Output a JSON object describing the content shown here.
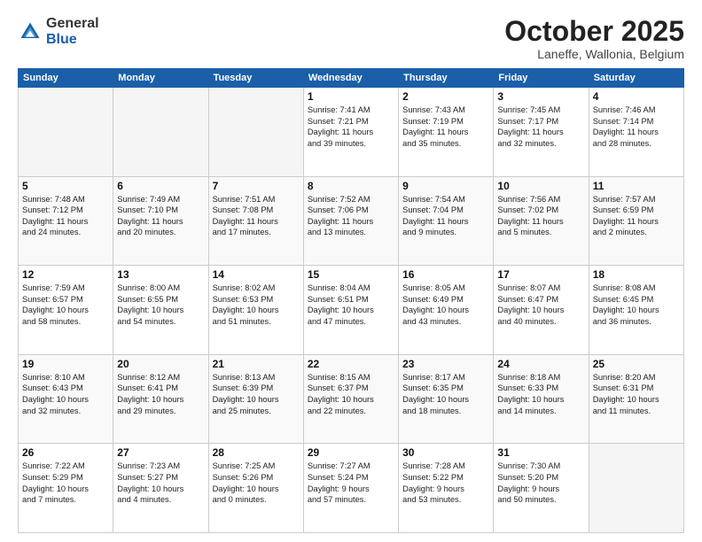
{
  "header": {
    "logo_general": "General",
    "logo_blue": "Blue",
    "month": "October 2025",
    "location": "Laneffe, Wallonia, Belgium"
  },
  "weekdays": [
    "Sunday",
    "Monday",
    "Tuesday",
    "Wednesday",
    "Thursday",
    "Friday",
    "Saturday"
  ],
  "weeks": [
    [
      {
        "day": "",
        "info": ""
      },
      {
        "day": "",
        "info": ""
      },
      {
        "day": "",
        "info": ""
      },
      {
        "day": "1",
        "info": "Sunrise: 7:41 AM\nSunset: 7:21 PM\nDaylight: 11 hours\nand 39 minutes."
      },
      {
        "day": "2",
        "info": "Sunrise: 7:43 AM\nSunset: 7:19 PM\nDaylight: 11 hours\nand 35 minutes."
      },
      {
        "day": "3",
        "info": "Sunrise: 7:45 AM\nSunset: 7:17 PM\nDaylight: 11 hours\nand 32 minutes."
      },
      {
        "day": "4",
        "info": "Sunrise: 7:46 AM\nSunset: 7:14 PM\nDaylight: 11 hours\nand 28 minutes."
      }
    ],
    [
      {
        "day": "5",
        "info": "Sunrise: 7:48 AM\nSunset: 7:12 PM\nDaylight: 11 hours\nand 24 minutes."
      },
      {
        "day": "6",
        "info": "Sunrise: 7:49 AM\nSunset: 7:10 PM\nDaylight: 11 hours\nand 20 minutes."
      },
      {
        "day": "7",
        "info": "Sunrise: 7:51 AM\nSunset: 7:08 PM\nDaylight: 11 hours\nand 17 minutes."
      },
      {
        "day": "8",
        "info": "Sunrise: 7:52 AM\nSunset: 7:06 PM\nDaylight: 11 hours\nand 13 minutes."
      },
      {
        "day": "9",
        "info": "Sunrise: 7:54 AM\nSunset: 7:04 PM\nDaylight: 11 hours\nand 9 minutes."
      },
      {
        "day": "10",
        "info": "Sunrise: 7:56 AM\nSunset: 7:02 PM\nDaylight: 11 hours\nand 5 minutes."
      },
      {
        "day": "11",
        "info": "Sunrise: 7:57 AM\nSunset: 6:59 PM\nDaylight: 11 hours\nand 2 minutes."
      }
    ],
    [
      {
        "day": "12",
        "info": "Sunrise: 7:59 AM\nSunset: 6:57 PM\nDaylight: 10 hours\nand 58 minutes."
      },
      {
        "day": "13",
        "info": "Sunrise: 8:00 AM\nSunset: 6:55 PM\nDaylight: 10 hours\nand 54 minutes."
      },
      {
        "day": "14",
        "info": "Sunrise: 8:02 AM\nSunset: 6:53 PM\nDaylight: 10 hours\nand 51 minutes."
      },
      {
        "day": "15",
        "info": "Sunrise: 8:04 AM\nSunset: 6:51 PM\nDaylight: 10 hours\nand 47 minutes."
      },
      {
        "day": "16",
        "info": "Sunrise: 8:05 AM\nSunset: 6:49 PM\nDaylight: 10 hours\nand 43 minutes."
      },
      {
        "day": "17",
        "info": "Sunrise: 8:07 AM\nSunset: 6:47 PM\nDaylight: 10 hours\nand 40 minutes."
      },
      {
        "day": "18",
        "info": "Sunrise: 8:08 AM\nSunset: 6:45 PM\nDaylight: 10 hours\nand 36 minutes."
      }
    ],
    [
      {
        "day": "19",
        "info": "Sunrise: 8:10 AM\nSunset: 6:43 PM\nDaylight: 10 hours\nand 32 minutes."
      },
      {
        "day": "20",
        "info": "Sunrise: 8:12 AM\nSunset: 6:41 PM\nDaylight: 10 hours\nand 29 minutes."
      },
      {
        "day": "21",
        "info": "Sunrise: 8:13 AM\nSunset: 6:39 PM\nDaylight: 10 hours\nand 25 minutes."
      },
      {
        "day": "22",
        "info": "Sunrise: 8:15 AM\nSunset: 6:37 PM\nDaylight: 10 hours\nand 22 minutes."
      },
      {
        "day": "23",
        "info": "Sunrise: 8:17 AM\nSunset: 6:35 PM\nDaylight: 10 hours\nand 18 minutes."
      },
      {
        "day": "24",
        "info": "Sunrise: 8:18 AM\nSunset: 6:33 PM\nDaylight: 10 hours\nand 14 minutes."
      },
      {
        "day": "25",
        "info": "Sunrise: 8:20 AM\nSunset: 6:31 PM\nDaylight: 10 hours\nand 11 minutes."
      }
    ],
    [
      {
        "day": "26",
        "info": "Sunrise: 7:22 AM\nSunset: 5:29 PM\nDaylight: 10 hours\nand 7 minutes."
      },
      {
        "day": "27",
        "info": "Sunrise: 7:23 AM\nSunset: 5:27 PM\nDaylight: 10 hours\nand 4 minutes."
      },
      {
        "day": "28",
        "info": "Sunrise: 7:25 AM\nSunset: 5:26 PM\nDaylight: 10 hours\nand 0 minutes."
      },
      {
        "day": "29",
        "info": "Sunrise: 7:27 AM\nSunset: 5:24 PM\nDaylight: 9 hours\nand 57 minutes."
      },
      {
        "day": "30",
        "info": "Sunrise: 7:28 AM\nSunset: 5:22 PM\nDaylight: 9 hours\nand 53 minutes."
      },
      {
        "day": "31",
        "info": "Sunrise: 7:30 AM\nSunset: 5:20 PM\nDaylight: 9 hours\nand 50 minutes."
      },
      {
        "day": "",
        "info": ""
      }
    ]
  ]
}
